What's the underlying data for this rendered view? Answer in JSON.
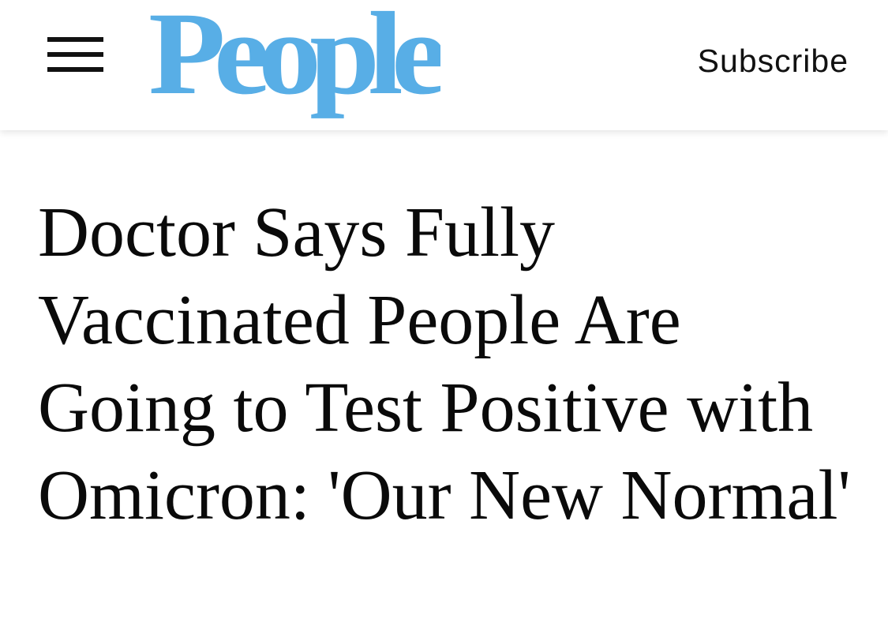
{
  "header": {
    "menu_icon": "hamburger-menu-icon",
    "logo_text": "People",
    "logo_color": "#58aee6",
    "subscribe_label": "Subscribe"
  },
  "article": {
    "headline": "Doctor Says Fully Vaccinated People Are Going to Test Positive with Omicron: 'Our New Normal'"
  }
}
